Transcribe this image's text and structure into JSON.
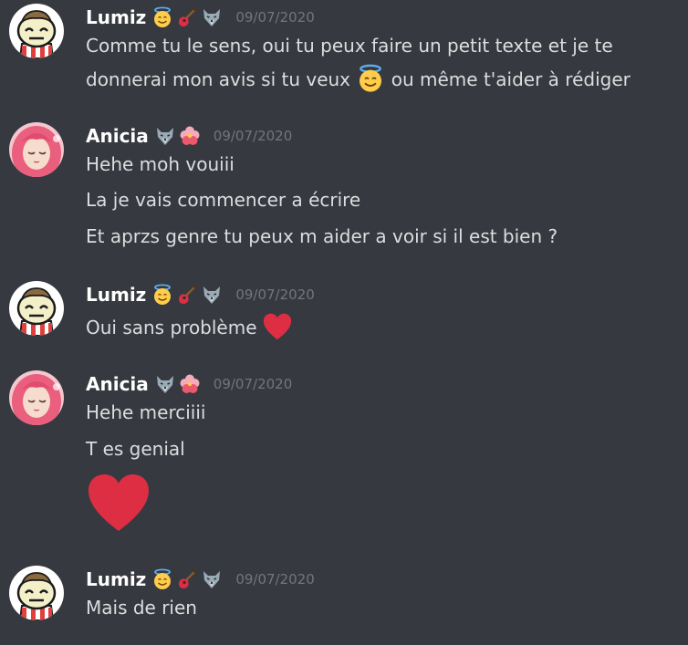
{
  "messages": [
    {
      "author": "Lumiz",
      "timestamp": "09/07/2020",
      "badges": [
        "halo-smile-emoji",
        "guitar-emoji",
        "wolf-emoji"
      ],
      "lines": [
        "Comme tu le sens, oui tu peux faire un petit texte et je te",
        "donnerai mon avis si tu veux",
        "ou même t'aider à rédiger"
      ]
    },
    {
      "author": "Anicia",
      "timestamp": "09/07/2020",
      "badges": [
        "wolf-emoji",
        "hibiscus-emoji"
      ],
      "lines": [
        "Hehe moh vouiii",
        "La je vais commencer a écrire",
        "Et aprzs genre tu peux m aider a voir si il est bien ?"
      ]
    },
    {
      "author": "Lumiz",
      "timestamp": "09/07/2020",
      "badges": [
        "halo-smile-emoji",
        "guitar-emoji",
        "wolf-emoji"
      ],
      "lines": [
        "Oui sans problème"
      ]
    },
    {
      "author": "Anicia",
      "timestamp": "09/07/2020",
      "badges": [
        "wolf-emoji",
        "hibiscus-emoji"
      ],
      "lines": [
        "Hehe merciiii",
        "T es genial"
      ],
      "attachment": "big-red-heart-emoji"
    },
    {
      "author": "Lumiz",
      "timestamp": "09/07/2020",
      "badges": [
        "halo-smile-emoji",
        "guitar-emoji",
        "wolf-emoji"
      ],
      "lines": [
        "Mais de rien"
      ]
    }
  ],
  "colors": {
    "background": "#36393f",
    "username": "#ffffff",
    "text": "#dcddde",
    "timestamp": "#72767d",
    "heart": "#dd2e44"
  }
}
